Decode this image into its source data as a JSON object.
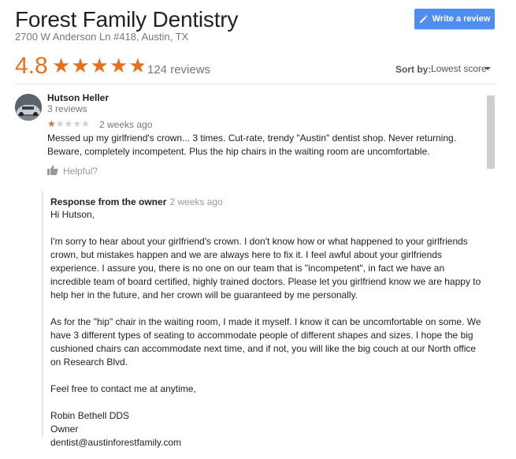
{
  "business": {
    "name": "Forest Family Dentistry",
    "address": "2700 W Anderson Ln #418, Austin, TX"
  },
  "write_review_button": {
    "label": "Write a review",
    "icon": "pencil-icon"
  },
  "rating": {
    "value": "4.8",
    "stars_filled": 4.8,
    "stars_max": 5,
    "reviews_count": "124 reviews",
    "star_color": "#e7711b"
  },
  "sort": {
    "label": "Sort by:",
    "value": "Lowest score"
  },
  "review": {
    "author": "Hutson Heller",
    "author_reviews": "3 reviews",
    "stars": 1,
    "stars_max": 5,
    "time": "2 weeks ago",
    "text": "Messed up my girlfriend's crown... 3 times. Cut-rate, trendy \"Austin\" dentist shop. Never returning. Beware, completely incompetent. Plus the hip chairs in the waiting room are uncomfortable.",
    "helpful_label": "Helpful?"
  },
  "owner_response": {
    "heading": "Response from the owner",
    "time": "2 weeks ago",
    "greeting": "Hi Hutson,",
    "paragraph1": "I'm sorry to hear about your girlfriend's crown. I don't know how or what happened to your girlfriends crown, but mistakes happen and we are always here to fix it. I feel awful about your girlfriends experience. I assure you, there is no one on our team that is \"incompetent\", in fact we have an incredible team of board certified, highly trained doctors. Please let you girlfriend know we are happy to help her in the future, and her crown will be guaranteed by me personally.",
    "paragraph2": "As for the \"hip\" chair in the waiting room, I made it myself. I know it can be uncomfortable on some. We have 3 different types of seating to accommodate people of different shapes and sizes. I hope the big cushioned chairs can accommodate next time, and if not, you will like the big couch at our North office on Research Blvd.",
    "paragraph3": "Feel free to contact me at anytime,",
    "signature_name": "Robin Bethell DDS",
    "signature_title": "Owner",
    "signature_email": "dentist@austinforestfamily.com"
  },
  "colors": {
    "accent_blue": "#4d8ef0",
    "star_orange": "#e7711b",
    "muted_text": "#777777"
  }
}
